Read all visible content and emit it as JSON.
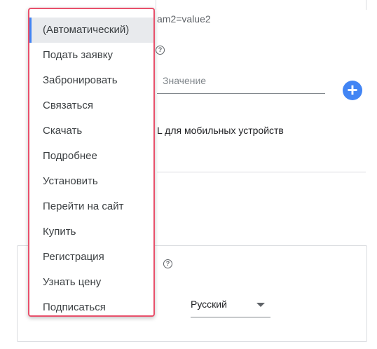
{
  "background_form": {
    "url_params_fragment": "am2=value2",
    "value_placeholder": "Значение",
    "add_button_symbol": "+",
    "mobile_url_fragment": "L для мобильных устройств",
    "help_symbol": "?",
    "language_selected": "Русский"
  },
  "dropdown": {
    "selected_index": 0,
    "items": [
      "(Автоматический)",
      "Подать заявку",
      "Забронировать",
      "Связаться",
      "Скачать",
      "Подробнее",
      "Установить",
      "Перейти на сайт",
      "Купить",
      "Регистрация",
      "Узнать цену",
      "Подписаться"
    ]
  },
  "colors": {
    "accent": "#4285f4",
    "menu_highlight_border": "#e8506b",
    "selected_background": "#e8eaed"
  }
}
